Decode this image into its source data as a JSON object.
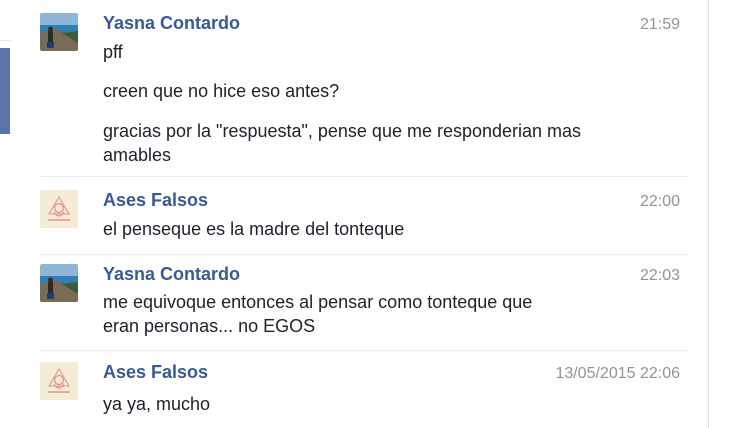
{
  "conversation": {
    "groups": [
      {
        "author": "Yasna Contardo",
        "time": "21:59",
        "messages": [
          "pff",
          "creen que no hice eso antes?",
          "gracias por la \"respuesta\", pense que me responderian mas amables"
        ]
      },
      {
        "author": "Ases Falsos",
        "time": "22:00",
        "messages": [
          "el penseque es la madre del tonteque"
        ]
      },
      {
        "author": "Yasna Contardo",
        "time": "22:03",
        "messages": [
          "me equivoque entonces al pensar  como tonteque que eran personas... no EGOS"
        ]
      },
      {
        "author": "Ases Falsos",
        "time": "13/05/2015 22:06",
        "messages": [
          "ya ya, mucho"
        ]
      }
    ]
  },
  "colors": {
    "author_name": "#3b5998",
    "timestamp": "#90949c",
    "message_text": "#1d2129",
    "left_tab": "#5b74a8"
  },
  "icons": {
    "yasna_avatar": "beach-photo-avatar",
    "ases_avatar": "ases-falsos-logo-avatar"
  }
}
